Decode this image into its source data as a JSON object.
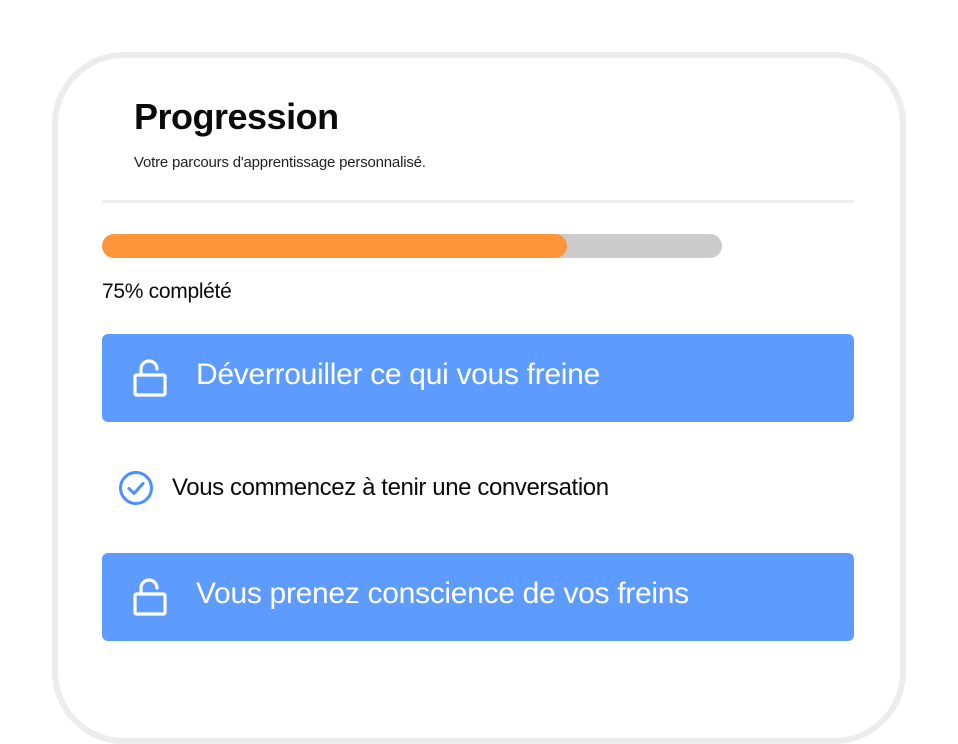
{
  "header": {
    "title": "Progression",
    "subtitle": "Votre parcours d'apprentissage personnalisé."
  },
  "progress": {
    "percent": 75,
    "label": "75% complété",
    "fill_color": "#ff953a",
    "track_color": "#cccccc"
  },
  "steps": [
    {
      "label": "Déverrouiller ce qui vous freine",
      "icon": "unlock-icon",
      "state": "unlocked"
    },
    {
      "label": "Vous commencez à tenir une conversation",
      "icon": "check-circle-icon",
      "state": "completed"
    },
    {
      "label": "Vous prenez conscience de vos freins",
      "icon": "unlock-icon",
      "state": "unlocked"
    }
  ],
  "colors": {
    "accent_blue": "#5e9bff",
    "check_blue": "#4a90ff",
    "frame": "#ececec"
  }
}
